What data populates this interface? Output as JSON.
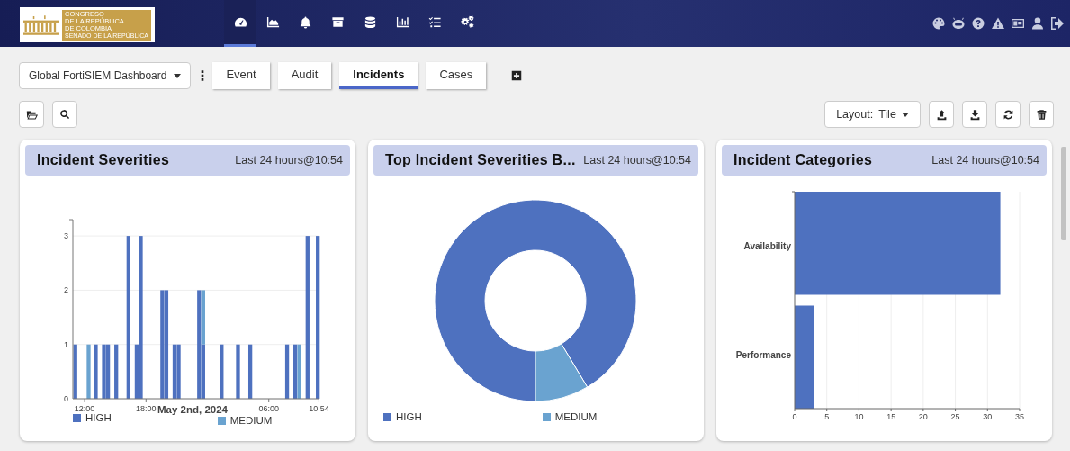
{
  "header": {
    "logo_lines": [
      "CONGRESO",
      "DE LA REPÚBLICA",
      "DE COLOMBIA",
      "SENADO DE LA REPÚBLICA"
    ],
    "nav": [
      {
        "selected": true
      },
      {
        "selected": false
      },
      {
        "selected": false
      },
      {
        "selected": false
      },
      {
        "selected": false
      },
      {
        "selected": false
      },
      {
        "selected": false
      },
      {
        "selected": false
      }
    ]
  },
  "toolbar": {
    "dashboard_select": "Global FortiSIEM Dashboard",
    "tabs": [
      {
        "label": "Event",
        "selected": false
      },
      {
        "label": "Audit",
        "selected": false
      },
      {
        "label": "Incidents",
        "selected": true
      },
      {
        "label": "Cases",
        "selected": false
      }
    ],
    "layout_select": {
      "label": "Layout:",
      "value": "Tile"
    }
  },
  "widgets": [
    {
      "title": "Incident Severities",
      "range": "Last 24 hours@10:54",
      "chart_data": {
        "type": "bar",
        "stacked": true,
        "grid": true,
        "xlabel": "May 2nd, 2024",
        "x": [
          "2024-05-01T10:54",
          "2024-05-01T12:12",
          "2024-05-01T12:54",
          "2024-05-01T13:42",
          "2024-05-01T14:06",
          "2024-05-01T14:54",
          "2024-05-01T16:06",
          "2024-05-01T16:54",
          "2024-05-01T17:18",
          "2024-05-01T19:24",
          "2024-05-01T19:48",
          "2024-05-01T20:36",
          "2024-05-01T21:00",
          "2024-05-01T23:00",
          "2024-05-01T23:24",
          "2024-05-02T01:12",
          "2024-05-02T02:48",
          "2024-05-02T04:00",
          "2024-05-02T07:36",
          "2024-05-02T08:24",
          "2024-05-02T08:48",
          "2024-05-02T09:36",
          "2024-05-02T10:36"
        ],
        "series": [
          {
            "name": "HIGH",
            "color": "#4e71bf",
            "values": [
              1,
              0,
              1,
              1,
              1,
              1,
              3,
              1,
              3,
              2,
              2,
              1,
              1,
              2,
              1,
              1,
              1,
              1,
              1,
              1,
              0,
              3,
              3
            ]
          },
          {
            "name": "MEDIUM",
            "color": "#6aa3d0",
            "values": [
              0,
              1,
              0,
              0,
              0,
              0,
              0,
              0,
              0,
              0,
              0,
              0,
              0,
              0,
              1,
              0,
              0,
              0,
              0,
              0,
              1,
              0,
              0
            ]
          }
        ],
        "xlim": [
          "2024-05-01T10:51",
          "2024-05-02T10:57"
        ],
        "ylim": [
          0,
          3.3
        ],
        "yticks": [
          0,
          1,
          2,
          3
        ],
        "xticks": [
          {
            "value": "2024-05-01T12:00",
            "label": "12:00"
          },
          {
            "value": "2024-05-01T18:00",
            "label": "18:00"
          },
          {
            "value": "2024-05-02T06:00",
            "label": "06:00"
          },
          {
            "value": "2024-05-02T10:54",
            "label": "10:54"
          }
        ]
      }
    },
    {
      "title": "Top Incident Severities B...",
      "range": "Last 24 hours@10:54",
      "chart_data": {
        "type": "donut",
        "categories": [
          "HIGH",
          "MEDIUM"
        ],
        "values": [
          91.4,
          8.6
        ],
        "colors": [
          "#4e71bf",
          "#6aa3d0"
        ]
      }
    },
    {
      "title": "Incident Categories",
      "range": "Last 24 hours@10:54",
      "chart_data": {
        "type": "bar",
        "orientation": "horizontal",
        "grid": true,
        "categories": [
          "Availability",
          "Performance"
        ],
        "values": [
          32,
          3
        ],
        "xlim": [
          0,
          35
        ],
        "xticks": [
          0,
          5,
          10,
          15,
          20,
          25,
          30,
          35
        ]
      }
    }
  ]
}
